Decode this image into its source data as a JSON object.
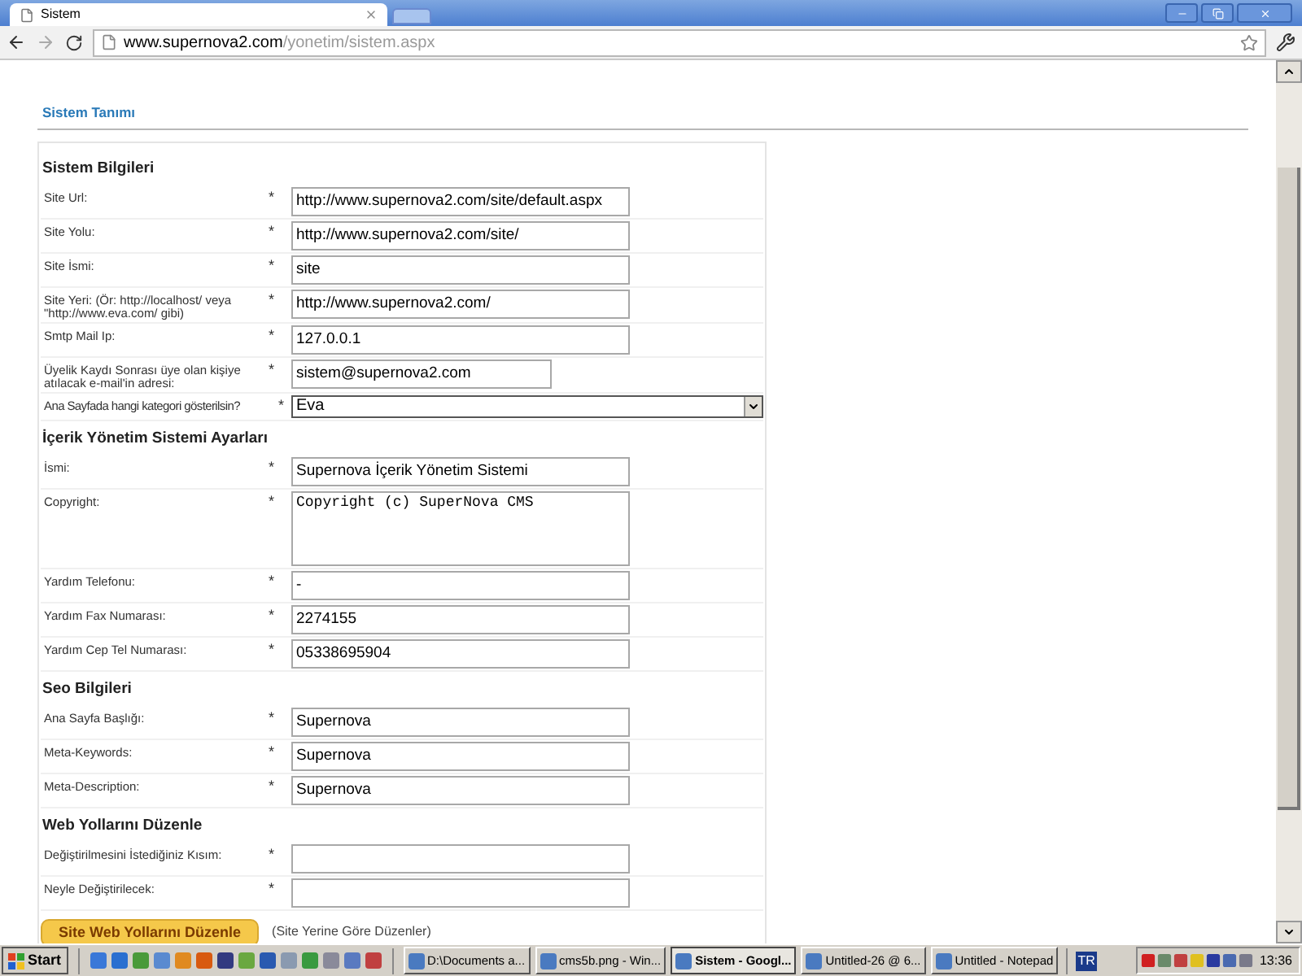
{
  "browser": {
    "tab_title": "Sistem",
    "address_host": "www.supernova2.com",
    "address_path": "/yonetim/sistem.aspx"
  },
  "page": {
    "title": "Sistem Tanımı",
    "sections": [
      {
        "heading": "Sistem Bilgileri",
        "fields": [
          {
            "kind": "text",
            "label": "Site Url:",
            "marker": "*",
            "value": "http://www.supernova2.com/site/default.aspx"
          },
          {
            "kind": "text",
            "label": "Site Yolu:",
            "marker": "*",
            "value": "http://www.supernova2.com/site/"
          },
          {
            "kind": "text",
            "label": "Site İsmi:",
            "marker": "*",
            "value": "site"
          },
          {
            "kind": "text",
            "label": "Site Yeri: (Ör: http://localhost/ veya \"http://www.eva.com/ gibi)",
            "marker": "*",
            "value": "http://www.supernova2.com/"
          },
          {
            "kind": "text",
            "label": "Smtp Mail Ip:",
            "marker": "*",
            "value": "127.0.0.1"
          },
          {
            "kind": "short",
            "label": "Üyelik Kaydı Sonrası üye olan kişiye atılacak e-mail'in adresi:",
            "marker": "*",
            "value": "sistem@supernova2.com"
          },
          {
            "kind": "select",
            "label": "Ana Sayfada hangi kategori gösterilsin?",
            "marker": "*",
            "value": "Eva"
          }
        ]
      },
      {
        "heading": "İçerik Yönetim Sistemi Ayarları",
        "fields": [
          {
            "kind": "text",
            "label": "İsmi:",
            "marker": "*",
            "value": "Supernova İçerik Yönetim Sistemi"
          },
          {
            "kind": "textarea",
            "label": "Copyright:",
            "marker": "*",
            "value": "Copyright (c) SuperNova CMS"
          },
          {
            "kind": "text",
            "label": "Yardım Telefonu:",
            "marker": "*",
            "value": "-"
          },
          {
            "kind": "text",
            "label": "Yardım Fax Numarası:",
            "marker": "*",
            "value": "2274155"
          },
          {
            "kind": "text",
            "label": "Yardım Cep Tel Numarası:",
            "marker": "*",
            "value": "05338695904"
          }
        ]
      },
      {
        "heading": "Seo Bilgileri",
        "fields": [
          {
            "kind": "text",
            "label": "Ana Sayfa Başlığı:",
            "marker": "*",
            "value": "Supernova"
          },
          {
            "kind": "text",
            "label": "Meta-Keywords:",
            "marker": "*",
            "value": "Supernova"
          },
          {
            "kind": "text",
            "label": "Meta-Description:",
            "marker": "*",
            "value": "Supernova"
          }
        ]
      },
      {
        "heading": "Web Yollarını Düzenle",
        "fields": [
          {
            "kind": "text",
            "label": "Değiştirilmesini İstediğiniz Kısım:",
            "marker": "*"
          },
          {
            "kind": "text",
            "label": "Neyle Değiştirilecek:",
            "marker": "*"
          }
        ]
      }
    ],
    "button": "Site Web Yollarını Düzenle",
    "button_note": "(Site Yerine Göre Düzenler)"
  },
  "taskbar": {
    "start": "Start",
    "tasks": [
      {
        "label": "D:\\Documents a...",
        "selected": false
      },
      {
        "label": "cms5b.png - Win...",
        "selected": false
      },
      {
        "label": "Sistem - Googl...",
        "selected": true
      },
      {
        "label": "Untitled-26 @ 6...",
        "selected": false
      },
      {
        "label": "Untitled - Notepad",
        "selected": false
      }
    ],
    "language": "TR",
    "clock": "13:36"
  }
}
